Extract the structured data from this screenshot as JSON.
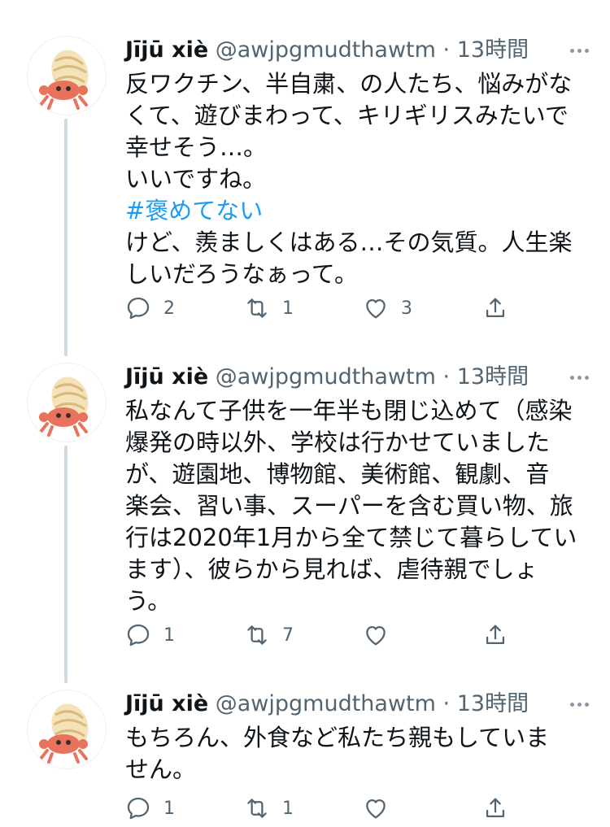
{
  "tweets": [
    {
      "author_name": "Jījū xiè",
      "handle": "@awjpgmudthawtm",
      "separator": "·",
      "time": "13時間",
      "lines": [
        "反ワクチン、半自粛、の人たち、悩みがな",
        "くて、遊びまわって、キリギリスみたいで",
        "幸せそう…。",
        "いいですね。"
      ],
      "hashtag": "#褒めてない",
      "lines_after": [
        "けど、羨ましくはある…その気質。人生楽",
        "しいだろうなぁって。"
      ],
      "replies": "2",
      "retweets": "1",
      "likes": "3"
    },
    {
      "author_name": "Jījū xiè",
      "handle": "@awjpgmudthawtm",
      "separator": "·",
      "time": "13時間",
      "lines": [
        "私なんて子供を一年半も閉じ込めて（感染",
        "爆発の時以外、学校は行かせていました",
        "が、遊園地、博物館、美術館、観劇、音",
        "楽会、習い事、スーパーを含む買い物、旅",
        "行は2020年1月から全て禁じて暮らしてい",
        "ます）、彼らから見れば、虐待親でしょ",
        "う。"
      ],
      "replies": "1",
      "retweets": "7",
      "likes": ""
    },
    {
      "author_name": "Jījū xiè",
      "handle": "@awjpgmudthawtm",
      "separator": "·",
      "time": "13時間",
      "lines": [
        "もちろん、外食など私たち親もしていま",
        "せん。"
      ],
      "replies": "1",
      "retweets": "1",
      "likes": ""
    }
  ]
}
